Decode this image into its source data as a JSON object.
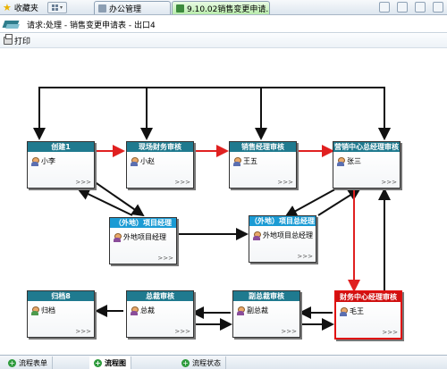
{
  "browser": {
    "favorites_label": "收藏夹",
    "tabs": [
      {
        "label": "办公管理"
      },
      {
        "label": "9.10.02销售变更申请..."
      }
    ]
  },
  "page": {
    "title": "请求:处理 - 销售变更申请表 - 出口4",
    "print_label": "打印"
  },
  "workflow": {
    "nodes": [
      {
        "id": "create",
        "title": "创建1",
        "user": "小李"
      },
      {
        "id": "field-finance",
        "title": "现场财务审核",
        "user": "小赵"
      },
      {
        "id": "sales-mgr",
        "title": "销售经理审核",
        "user": "王五"
      },
      {
        "id": "marketing-gm",
        "title": "营销中心总经理审核",
        "user": "张三"
      },
      {
        "id": "ext-proj-mgr",
        "title": "（外地）项目经理",
        "user": "外地项目经理"
      },
      {
        "id": "ext-proj-gm",
        "title": "（外地）项目总经理",
        "user": "外地项目总经理"
      },
      {
        "id": "archive",
        "title": "归档8",
        "user": "归档"
      },
      {
        "id": "ceo-review",
        "title": "总裁审核",
        "user": "总裁"
      },
      {
        "id": "vp-review",
        "title": "副总裁审核",
        "user": "副总裁"
      },
      {
        "id": "finance-gm",
        "title": "财务中心经理审核",
        "user": "毛王"
      }
    ],
    "more_label": ">>>",
    "active_color": "#d01010",
    "header_color": "#1f7a8f",
    "arrow_red": "#e02020",
    "arrow_black": "#111111"
  },
  "bottom_tabs": [
    {
      "label": "流程表单"
    },
    {
      "label": "流程图"
    },
    {
      "label": "流程状态"
    }
  ]
}
